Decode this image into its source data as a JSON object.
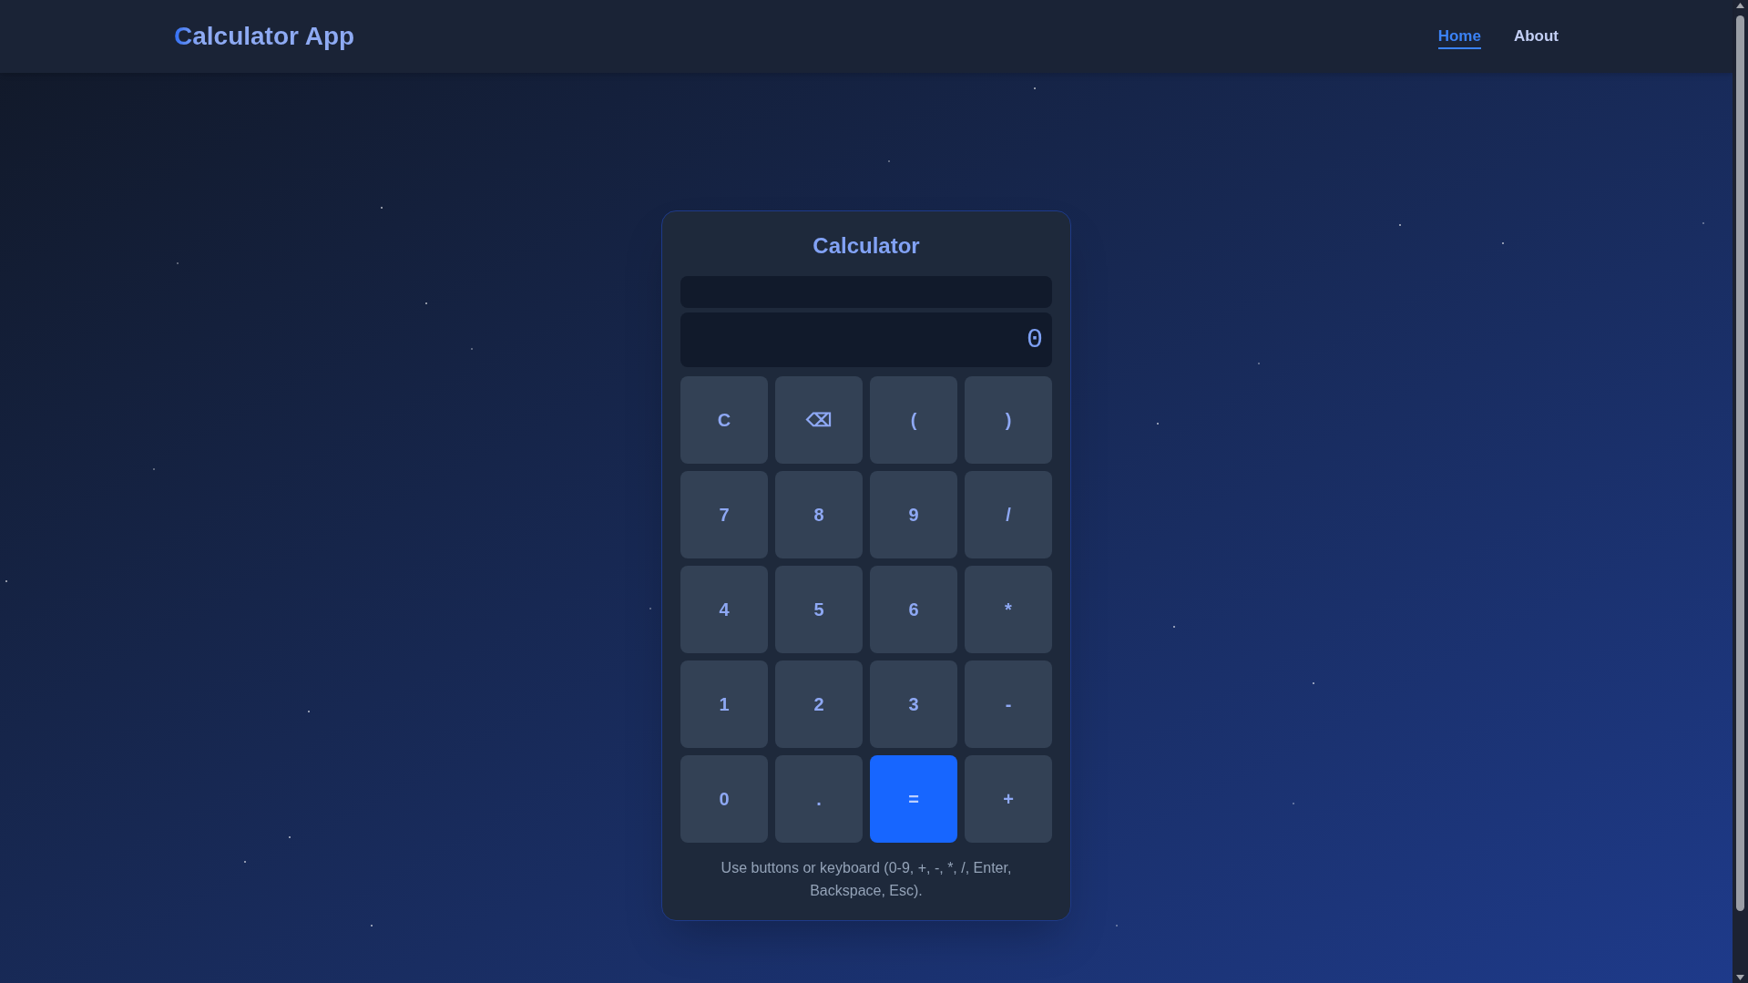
{
  "header": {
    "logo": "Calculator App",
    "nav": [
      {
        "label": "Home",
        "selected": true
      },
      {
        "label": "About",
        "selected": false
      }
    ]
  },
  "calculator": {
    "title": "Calculator",
    "result": "0",
    "keys": [
      {
        "label": "C",
        "kind": "clear"
      },
      {
        "label": "⌫",
        "kind": "backspace"
      },
      {
        "label": "(",
        "kind": "paren"
      },
      {
        "label": ")",
        "kind": "paren"
      },
      {
        "label": "7",
        "kind": "digit"
      },
      {
        "label": "8",
        "kind": "digit"
      },
      {
        "label": "9",
        "kind": "digit"
      },
      {
        "label": "/",
        "kind": "operator"
      },
      {
        "label": "4",
        "kind": "digit"
      },
      {
        "label": "5",
        "kind": "digit"
      },
      {
        "label": "6",
        "kind": "digit"
      },
      {
        "label": "*",
        "kind": "operator"
      },
      {
        "label": "1",
        "kind": "digit"
      },
      {
        "label": "2",
        "kind": "digit"
      },
      {
        "label": "3",
        "kind": "digit"
      },
      {
        "label": "-",
        "kind": "operator"
      },
      {
        "label": "0",
        "kind": "digit"
      },
      {
        "label": ".",
        "kind": "decimal"
      },
      {
        "label": "=",
        "kind": "equals"
      },
      {
        "label": "+",
        "kind": "operator"
      }
    ],
    "hint": "Use buttons or keyboard (0-9, +, -, *, /, Enter, Backspace, Esc)."
  }
}
